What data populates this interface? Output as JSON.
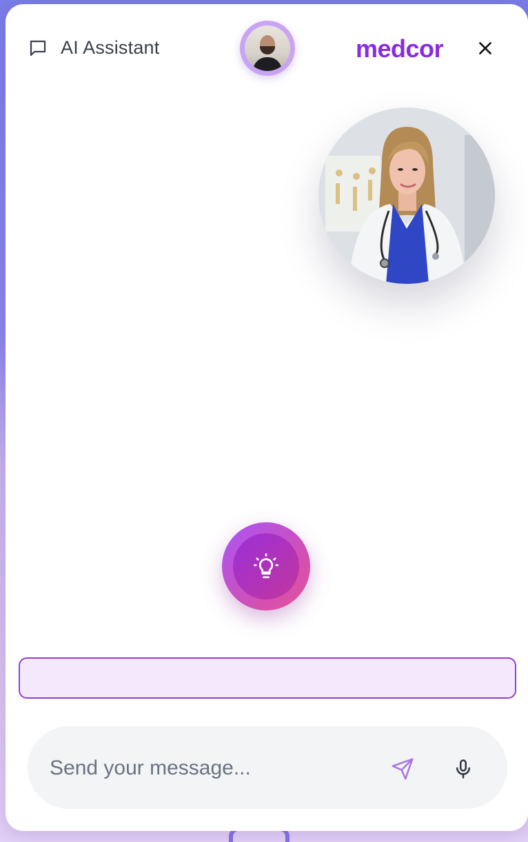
{
  "header": {
    "title": "AI Assistant",
    "brand": "medcor",
    "brand_color": "#8a2be2",
    "chat_icon": "chat-bubble-icon",
    "close_icon": "close-icon"
  },
  "avatars": {
    "user": "user-avatar",
    "doctor": "doctor-avatar"
  },
  "assistant_button": {
    "icon": "lightbulb-icon"
  },
  "transcript": {
    "text": ""
  },
  "composer": {
    "placeholder": "Send your message...",
    "value": "",
    "send_icon": "send-icon",
    "mic_icon": "microphone-icon"
  },
  "colors": {
    "accent": "#8a2be2",
    "transcript_bg": "#f3e8fc",
    "transcript_border": "#8f3fd1",
    "composer_bg": "#f3f4f6"
  }
}
